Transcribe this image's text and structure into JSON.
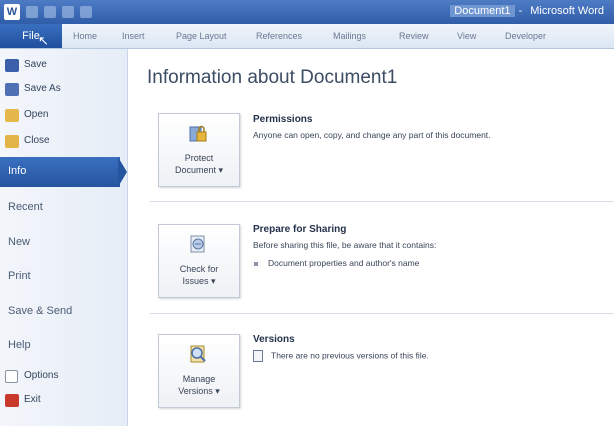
{
  "titlebar": {
    "app_icon": "W",
    "doc_title": "Document1",
    "separator": "-",
    "app_name": "Microsoft Word"
  },
  "tabs": {
    "file": "File",
    "items": [
      "Home",
      "Insert",
      "Page Layout",
      "References",
      "Mailings",
      "Review",
      "View",
      "Developer"
    ]
  },
  "menu": {
    "save": "Save",
    "save_as": "Save As",
    "open": "Open",
    "close": "Close",
    "info": "Info",
    "recent": "Recent",
    "new": "New",
    "print": "Print",
    "save_send": "Save & Send",
    "help": "Help",
    "options": "Options",
    "exit": "Exit"
  },
  "main": {
    "title": "Information about Document1",
    "permissions": {
      "button": [
        "Protect",
        "Document ▾"
      ],
      "heading": "Permissions",
      "desc": "Anyone can open, copy, and change any part of this document."
    },
    "sharing": {
      "button": [
        "Check for",
        "Issues ▾"
      ],
      "heading": "Prepare for Sharing",
      "desc": "Before sharing this file, be aware that it contains:",
      "bullet": "Document properties and author's name"
    },
    "versions": {
      "button": [
        "Manage",
        "Versions ▾"
      ],
      "heading": "Versions",
      "desc": "There are no previous versions of this file."
    }
  },
  "colors": {
    "accent": "#2b579a",
    "selected": "#26559f"
  }
}
